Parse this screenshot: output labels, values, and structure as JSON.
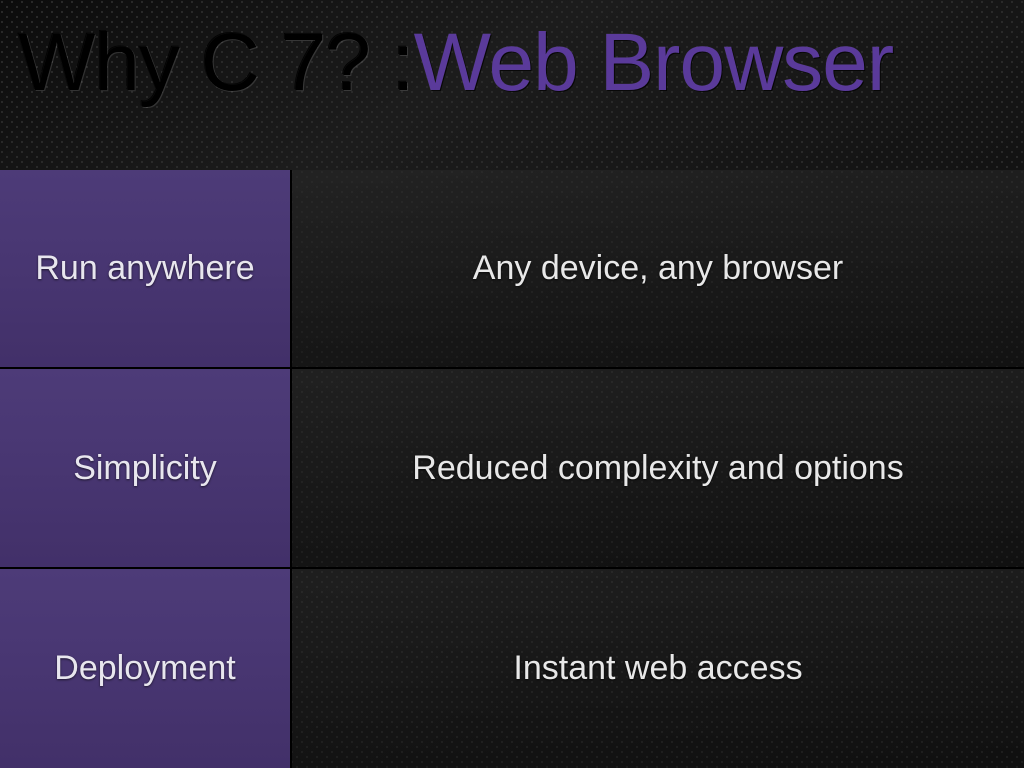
{
  "title_prefix": "Why C 7? :",
  "title_accent": "Web Browser",
  "rows": [
    {
      "label": "Run anywhere",
      "desc": "Any device, any browser"
    },
    {
      "label": "Simplicity",
      "desc": "Reduced complexity and options"
    },
    {
      "label": "Deployment",
      "desc": "Instant web access"
    }
  ]
}
